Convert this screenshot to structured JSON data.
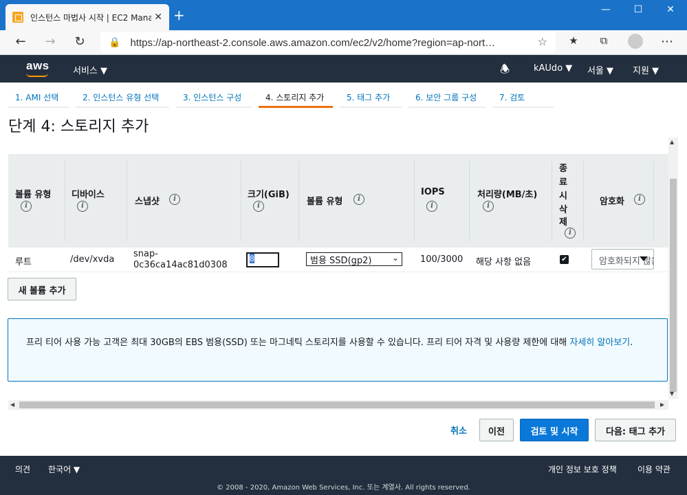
{
  "browser": {
    "tab_title": "인스턴스 마법사 시작 | EC2 Mana",
    "tab_close": "✕",
    "new_tab": "+",
    "url": "https://ap-northeast-2.console.aws.amazon.com/ec2/v2/home?region=ap-nort…",
    "win_min": "—",
    "win_max": "☐",
    "win_close": "✕"
  },
  "awsnav": {
    "logo": "aws",
    "services": "서비스 ▼",
    "user": "kAUdo ▼",
    "region": "서울 ▼",
    "support": "지원 ▼"
  },
  "steps": [
    {
      "label": "1. AMI 선택"
    },
    {
      "label": "2. 인스턴스 유형 선택"
    },
    {
      "label": "3. 인스턴스 구성"
    },
    {
      "label": "4. 스토리지 추가"
    },
    {
      "label": "5. 태그 추가"
    },
    {
      "label": "6. 보안 그룹 구성"
    },
    {
      "label": "7. 검토"
    }
  ],
  "page_title": "단계 4: 스토리지 추가",
  "table": {
    "headers": {
      "volume_type": "볼륨 유형",
      "device": "디바이스",
      "snapshot": "스냅샷",
      "size": "크기(GiB)",
      "volume_kind": "볼륨 유형",
      "iops": "IOPS",
      "throughput": "처리량(MB/초)",
      "delete_1": "종",
      "delete_2": "료",
      "delete_3": "시",
      "delete_4": "삭",
      "delete_5": "제",
      "encryption": "암호화",
      "info": "i"
    },
    "row": {
      "volume_type": "루트",
      "device": "/dev/xvda",
      "snapshot_1": "snap-",
      "snapshot_2": "0c36ca14ac81d0308",
      "size": "8",
      "volume_kind": "범용 SSD(gp2)",
      "iops": "100/3000",
      "throughput": "해당 사항 없음",
      "check": "✔",
      "encryption": "암호화되지 않음"
    }
  },
  "add_volume_button": "새 볼륨 추가",
  "info_box": {
    "text": "프리 티어 사용 가능 고객은 최대 30GB의 EBS 범용(SSD) 또는 마그네틱 스토리지를 사용할 수 있습니다. 프리 티어 자격 및 사용량 제한에 대해 ",
    "link": "자세히 알아보기",
    "tail": "."
  },
  "actions": {
    "cancel": "취소",
    "previous": "이전",
    "review_launch": "검토 및 시작",
    "next": "다음: 태그 추가"
  },
  "footer": {
    "feedback": "의견",
    "language": "한국어 ▼",
    "privacy": "개인 정보 보호 정책",
    "terms": "이용 약관",
    "copyright": "© 2008 - 2020, Amazon Web Services, Inc. 또는 계열사. All rights reserved."
  }
}
